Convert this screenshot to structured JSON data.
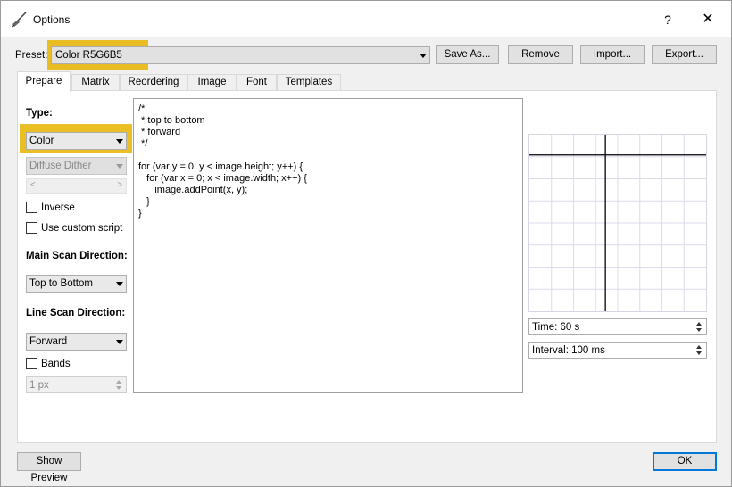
{
  "window": {
    "title": "Options",
    "help_glyph": "?",
    "close_glyph": "✕"
  },
  "preset": {
    "label": "Preset:",
    "value": "Color R5G6B5",
    "buttons": {
      "save_as": "Save As...",
      "remove": "Remove",
      "import": "Import...",
      "export": "Export..."
    }
  },
  "tabs": [
    {
      "label": "Prepare",
      "active": true
    },
    {
      "label": "Matrix"
    },
    {
      "label": "Reordering"
    },
    {
      "label": "Image"
    },
    {
      "label": "Font"
    },
    {
      "label": "Templates"
    }
  ],
  "prepare": {
    "type_label": "Type:",
    "type_value": "Color",
    "dither_value": "Diffuse Dither",
    "scroll_left": "<",
    "scroll_right": ">",
    "inverse_label": "Inverse",
    "custom_script_label": "Use custom script",
    "main_scan_label": "Main Scan Direction:",
    "main_scan_value": "Top to Bottom",
    "line_scan_label": "Line Scan Direction:",
    "line_scan_value": "Forward",
    "bands_label": "Bands",
    "bands_value": "1 px",
    "script": "/*\n * top to bottom\n * forward\n */\n\nfor (var y = 0; y < image.height; y++) {\n   for (var x = 0; x < image.width; x++) {\n      image.addPoint(x, y);\n   }\n}"
  },
  "preview": {
    "time_value": "Time: 60 s",
    "interval_value": "Interval: 100 ms"
  },
  "footer": {
    "show_preview": "Show Preview",
    "ok": "OK"
  },
  "colors": {
    "highlight": "#e6b400",
    "ok_border": "#0078d7"
  }
}
